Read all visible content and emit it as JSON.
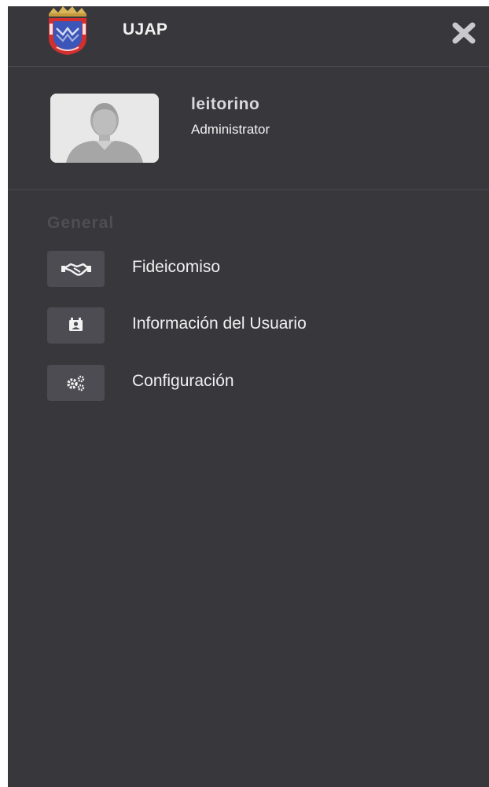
{
  "header": {
    "title": "UJAP",
    "logo_icon": "ujap-crest-logo",
    "close_icon": "close-x-icon"
  },
  "profile": {
    "username": "leitorino",
    "role": "Administrator",
    "avatar_icon": "default-user-avatar"
  },
  "menu": {
    "section_title": "General",
    "items": [
      {
        "label": "Fideicomiso",
        "icon": "handshake-icon"
      },
      {
        "label": "Información del Usuario",
        "icon": "contact-card-icon"
      },
      {
        "label": "Configuración",
        "icon": "gears-icon"
      }
    ]
  },
  "colors": {
    "sidebar_bg": "#38373c",
    "icon_box_bg": "#4d4c52",
    "divider": "#4a4950",
    "section_title": "#4f4e55",
    "text": "#f0f0f0"
  }
}
